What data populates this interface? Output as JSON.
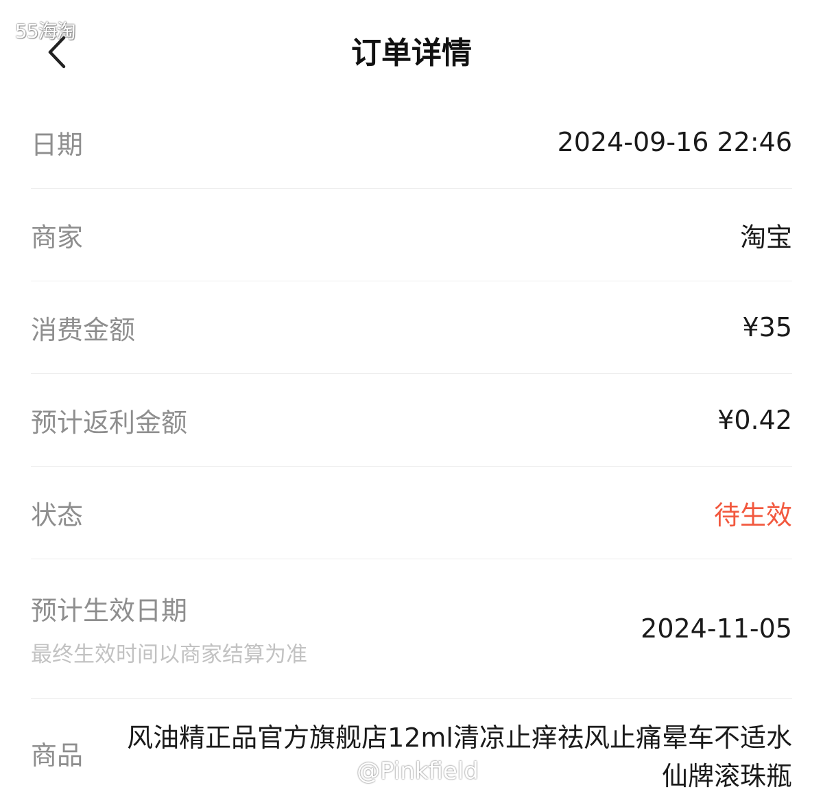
{
  "watermarks": {
    "top": "55海淘",
    "bottom": "@Pinkfield"
  },
  "header": {
    "title": "订单详情",
    "back_icon": "chevron-left-icon"
  },
  "rows": {
    "date": {
      "label": "日期",
      "value": "2024-09-16 22:46"
    },
    "merchant": {
      "label": "商家",
      "value": "淘宝"
    },
    "amount": {
      "label": "消费金额",
      "value": "¥35"
    },
    "rebate": {
      "label": "预计返利金额",
      "value": "¥0.42"
    },
    "status": {
      "label": "状态",
      "value": "待生效",
      "color": "#f2583e"
    },
    "effective": {
      "label": "预计生效日期",
      "note": "最终生效时间以商家结算为准",
      "value": "2024-11-05"
    },
    "product": {
      "label": "商品",
      "value": "风油精正品官方旗舰店12ml清凉止痒祛风止痛晕车不适水仙牌滚珠瓶"
    }
  }
}
